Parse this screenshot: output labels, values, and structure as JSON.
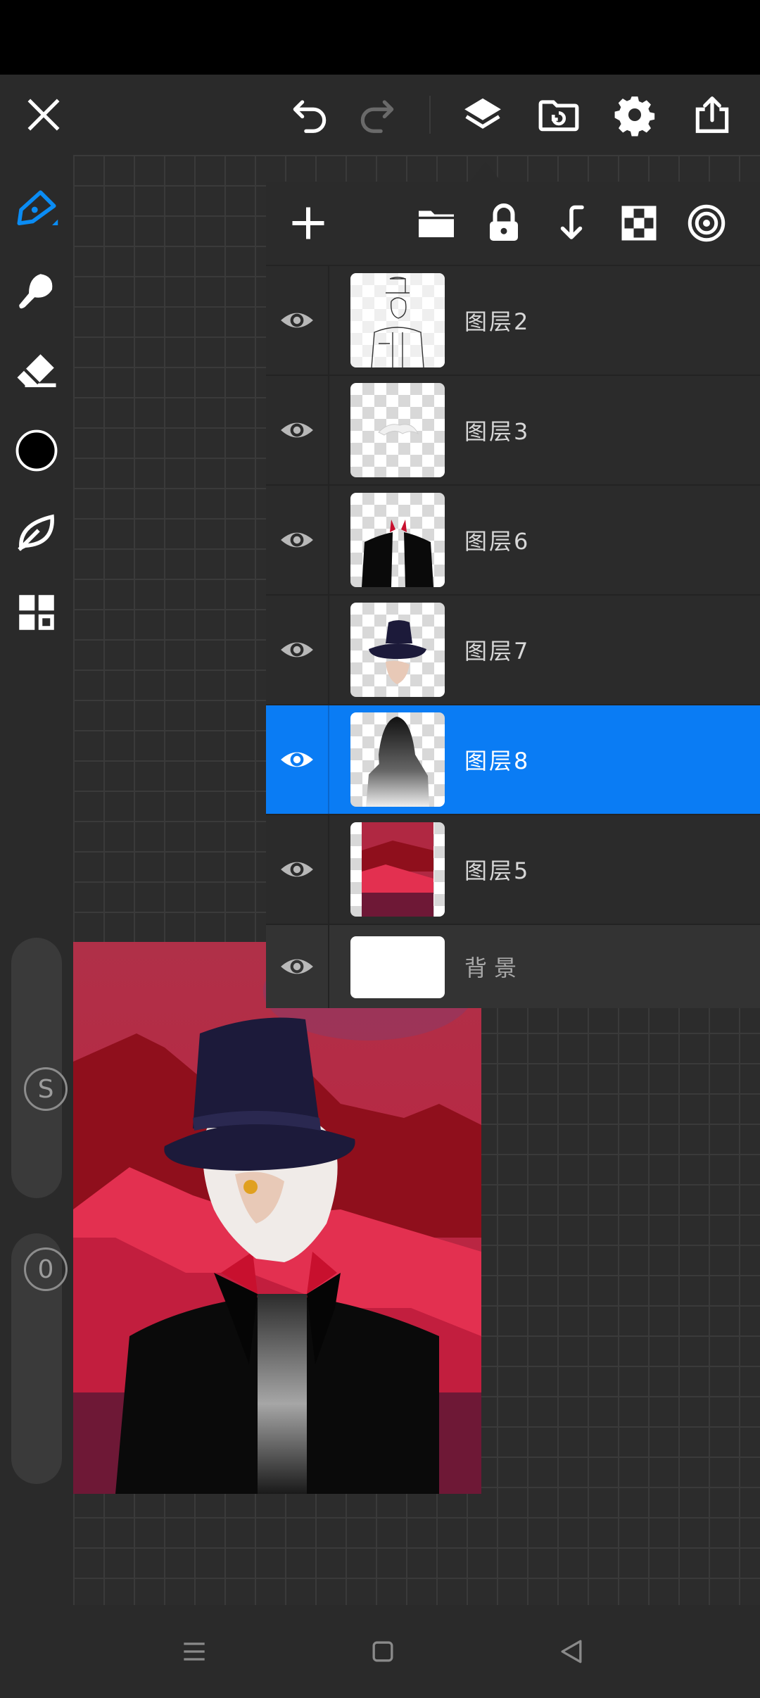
{
  "app": {
    "top_toolbar": {
      "close": {
        "icon": "close-icon"
      },
      "undo": {
        "icon": "undo-icon"
      },
      "redo": {
        "icon": "redo-icon"
      },
      "layers": {
        "icon": "layers-icon"
      },
      "import": {
        "icon": "folder-import-icon"
      },
      "settings": {
        "icon": "gear-icon"
      },
      "export": {
        "icon": "share-icon"
      }
    },
    "left_toolbar": {
      "tools": [
        {
          "name": "pen",
          "icon": "pen-icon",
          "active": true
        },
        {
          "name": "smudge",
          "icon": "smudge-icon"
        },
        {
          "name": "eraser",
          "icon": "eraser-icon"
        },
        {
          "name": "color",
          "icon": "color-swatch",
          "color": "#000000"
        },
        {
          "name": "brush-library",
          "icon": "leaf-icon"
        },
        {
          "name": "more",
          "icon": "grid-icon"
        }
      ],
      "size_slider_label": "S",
      "opacity_slider_label": "0"
    },
    "layers_panel": {
      "tools": [
        "add-icon",
        "folder-icon",
        "lock-icon",
        "merge-down-icon",
        "transparency-icon",
        "blend-icon"
      ],
      "layers": [
        {
          "name": "图层2",
          "visible": true,
          "selected": false
        },
        {
          "name": "图层3",
          "visible": true,
          "selected": false
        },
        {
          "name": "图层6",
          "visible": true,
          "selected": false
        },
        {
          "name": "图层7",
          "visible": true,
          "selected": false
        },
        {
          "name": "图层8",
          "visible": true,
          "selected": true
        },
        {
          "name": "图层5",
          "visible": true,
          "selected": false
        }
      ],
      "background": {
        "name": "背景",
        "visible": true
      }
    },
    "accent_color": "#0a7cf4"
  },
  "nav_bar": {
    "buttons": [
      "menu-icon",
      "home-icon",
      "back-icon"
    ]
  }
}
